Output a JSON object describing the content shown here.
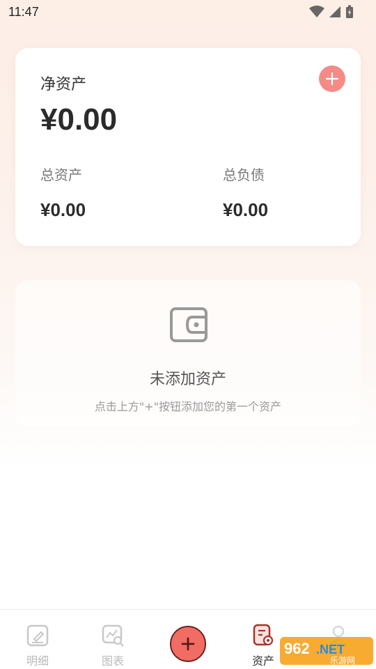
{
  "status_bar": {
    "time": "11:47"
  },
  "summary_card": {
    "net_assets_label": "净资产",
    "net_assets_value": "¥0.00",
    "total_assets_label": "总资产",
    "total_assets_value": "¥0.00",
    "total_liabilities_label": "总负债",
    "total_liabilities_value": "¥0.00"
  },
  "empty_state": {
    "title": "未添加资产",
    "hint": "点击上方\"+\"按钮添加您的第一个资产"
  },
  "tab_bar": {
    "tabs": [
      {
        "label": "明细",
        "icon": "edit-note-icon"
      },
      {
        "label": "图表",
        "icon": "chart-search-icon"
      },
      {
        "label": "资产",
        "icon": "asset-doc-icon",
        "active": true
      }
    ]
  },
  "watermark": {
    "number": "962",
    "suffix": ".NET",
    "subtitle": "乐游网"
  },
  "colors": {
    "accent": "#f58b86",
    "center_button": "#f16d63",
    "active_icon": "#c0392b"
  }
}
